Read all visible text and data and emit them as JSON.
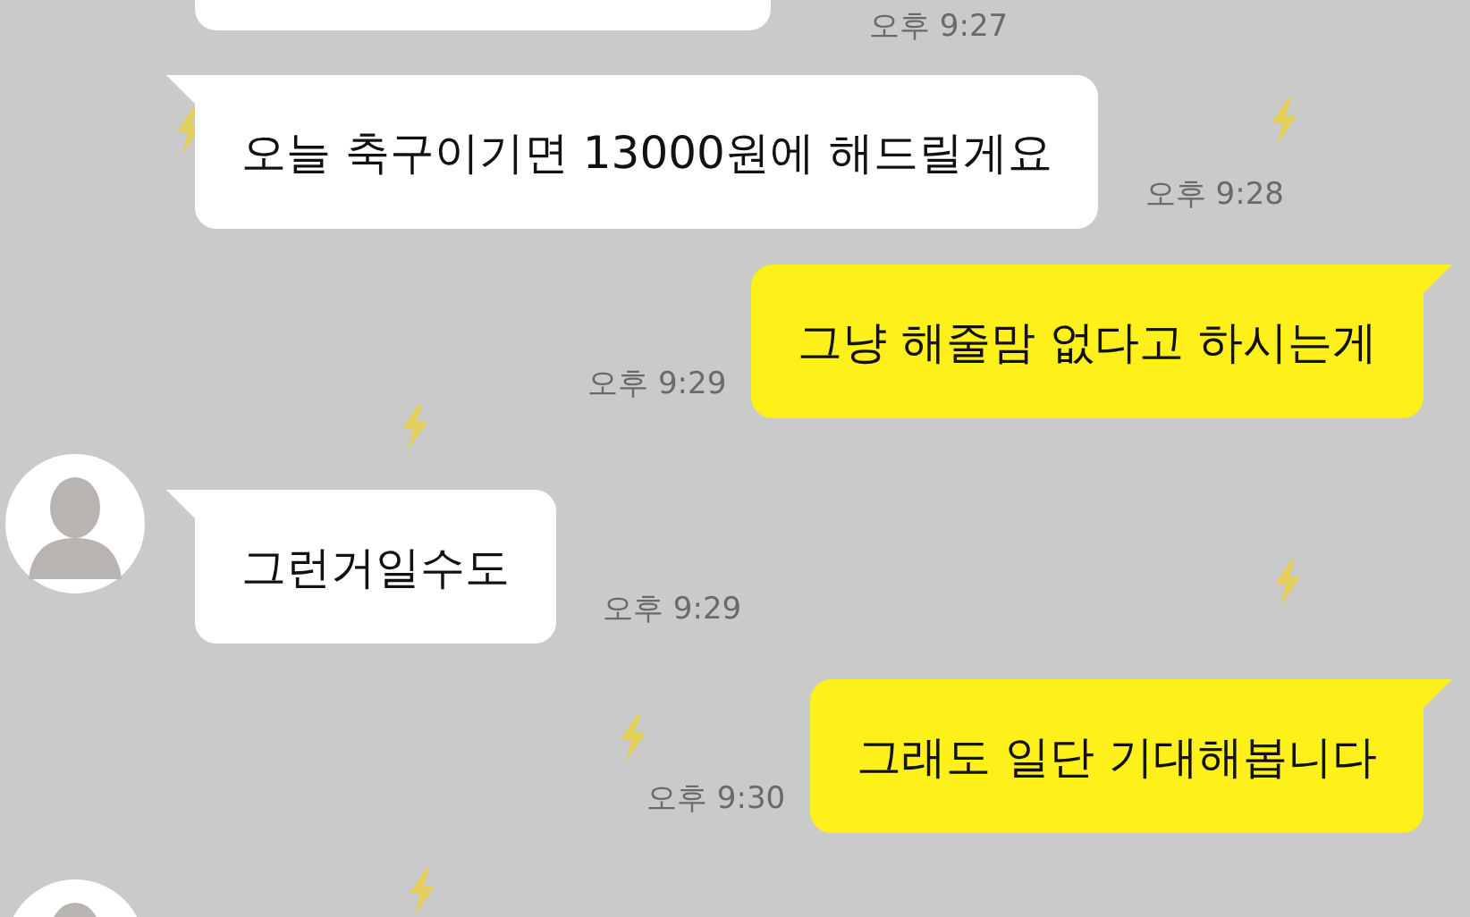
{
  "messages": [
    {
      "kind": "received",
      "avatar": false,
      "time": "오후 9:27"
    },
    {
      "kind": "received",
      "avatar": false,
      "text": "오늘 축구이기면 13000원에 해드릴게요",
      "time": "오후 9:28"
    },
    {
      "kind": "sent",
      "text": "그냥 해줄맘 없다고 하시는게",
      "time": "오후 9:29"
    },
    {
      "kind": "received",
      "avatar": true,
      "text": "그런거일수도",
      "time": "오후 9:29"
    },
    {
      "kind": "sent",
      "text": "그래도 일단 기대해봅니다",
      "time": "오후 9:30"
    },
    {
      "kind": "received",
      "avatar": true
    }
  ]
}
